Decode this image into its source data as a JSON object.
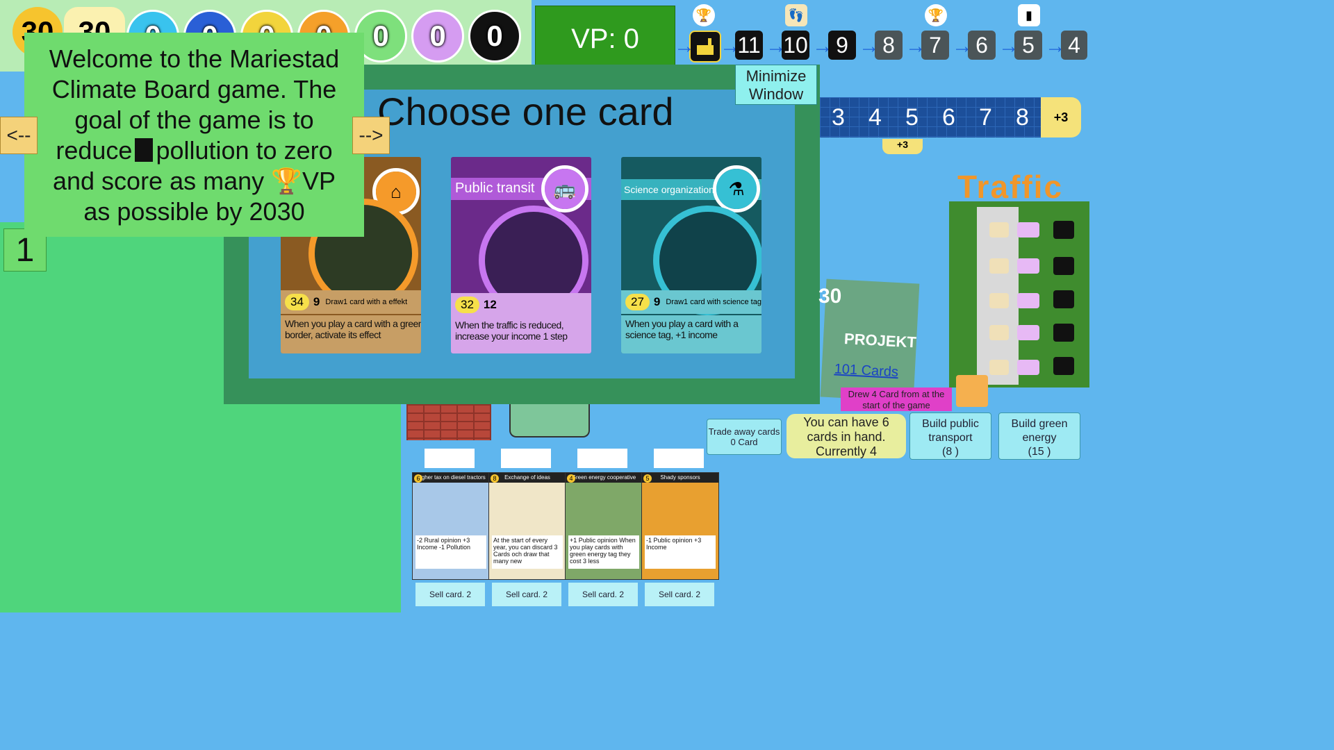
{
  "topbar": {
    "round_left": "30",
    "round_right": "30",
    "resources": [
      {
        "icon": "lightbulb-icon",
        "value": "0",
        "color": "#39c3ee"
      },
      {
        "icon": "globe-icon",
        "value": "0",
        "color": "#2a5fd6"
      },
      {
        "icon": "yin-yang-icon",
        "value": "0",
        "color": "#f2d43c"
      },
      {
        "icon": "house-icon",
        "value": "0",
        "color": "#f5a02a"
      },
      {
        "icon": "tree-icon",
        "value": "0",
        "color": "#7ee07c"
      },
      {
        "icon": "bus-icon",
        "value": "0",
        "color": "#d59cf1"
      },
      {
        "icon": "star-icon",
        "value": "0",
        "color": "#111111"
      }
    ]
  },
  "vp": {
    "label": "VP: 0"
  },
  "track": {
    "steps": [
      "11",
      "10",
      "9",
      "8",
      "7",
      "6",
      "5",
      "4"
    ]
  },
  "welcome": {
    "line1": "Welcome to the Mariestad",
    "line2": "Climate Board game. The",
    "line3": "goal of the game is to",
    "line4a": "reduce",
    "line4b": "pollution to zero",
    "line5a": "and score as many",
    "line5b": "VP",
    "line6": "as possible by 2030",
    "prev": "<--",
    "next": "-->",
    "page_number": "1"
  },
  "modal": {
    "title": "Choose one card",
    "minimize_line1": "Minimize",
    "minimize_line2": "Window",
    "cards": [
      {
        "name": "",
        "cost": "34",
        "income": "9",
        "effect": "Draw1 card with a effekt",
        "desc": "When you play a card with a green border, activate its effect",
        "color": "#a77a3b",
        "ring": "#f59a2a"
      },
      {
        "name": "Public transit",
        "cost": "32",
        "income": "12",
        "effect": "",
        "desc": "When the traffic is reduced, increase your income 1 step",
        "color": "#7a2f9d",
        "ring": "#c776f0"
      },
      {
        "name": "Science organization",
        "cost": "27",
        "income": "9",
        "effect": "Draw1 card with science tag",
        "desc": "When you play a card with a science tag, +1 income",
        "color": "#1f6f78",
        "ring": "#36c0d4"
      }
    ]
  },
  "scale": {
    "ticks": [
      "3",
      "4",
      "5",
      "6",
      "7",
      "8"
    ],
    "bonus": "+3",
    "tag": "+3"
  },
  "traffic": {
    "title": "Traffic"
  },
  "projekt": {
    "round": "30",
    "title": "PROJEKT",
    "cards": "101 Cards",
    "drew": "Drew 4 Card from at the start of the game"
  },
  "actions": {
    "trade_line1": "Trade away cards",
    "trade_line2": "0 Card",
    "hand_line1": "You can have 6",
    "hand_line2": "cards in hand.",
    "hand_line3": "Currently 4",
    "build_transport_line1": "Build public",
    "build_transport_line2": "transport",
    "build_transport_line3": "(8 )",
    "build_green_line1": "Build green",
    "build_green_line2": "energy",
    "build_green_line3": "(15 )"
  },
  "hand": [
    {
      "cost": "6",
      "title": "Higher tax on diesel tractors",
      "text": "-2 Rural opinion +3 Income -1 Pollution",
      "sell": "Sell card. 2"
    },
    {
      "cost": "8",
      "title": "Exchange of ideas",
      "text": "At the start of every year, you can discard 3 Cards och draw that many new",
      "sell": "Sell card. 2"
    },
    {
      "cost": "4",
      "title": "Green energy cooperative",
      "text": "+1 Public opinion When you play cards with green energy tag they cost 3 less",
      "sell": "Sell card. 2"
    },
    {
      "cost": "5",
      "title": "Shady sponsors",
      "text": "-1 Public opinion +3 Income",
      "sell": "Sell card. 2"
    }
  ]
}
